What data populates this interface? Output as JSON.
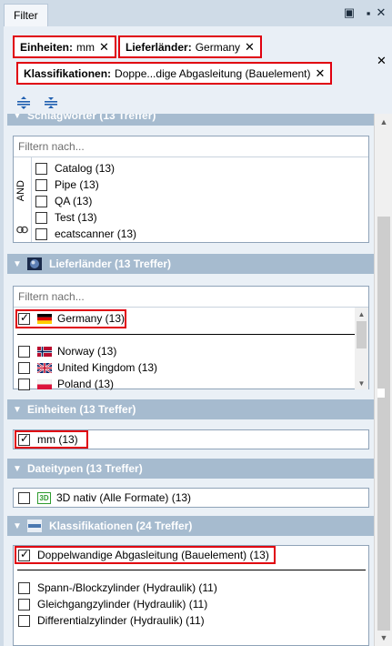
{
  "window": {
    "tab_label": "Filter",
    "pin_glyph": "▣",
    "restore_glyph": "▪",
    "close_glyph": "✕"
  },
  "active_filters": [
    {
      "key": "Einheiten:",
      "value": "mm"
    },
    {
      "key": "Lieferländer:",
      "value": "Germany"
    },
    {
      "key": "Klassifikationen:",
      "value": "Doppe...dige Abgasleitung (Bauelement)"
    }
  ],
  "chip_close_glyph": "✕",
  "filterbar_close_glyph": "✕",
  "placeholder": "Filtern nach...",
  "keywords": {
    "header_partial": "Schlagwörter (13 Treffer)",
    "and_label": "AND",
    "items": [
      "Catalog (13)",
      "Pipe (13)",
      "QA (13)",
      "Test (13)",
      "ecatscanner (13)"
    ]
  },
  "countries": {
    "header": "Lieferländer (13 Treffer)",
    "selected": "Germany (13)",
    "items": [
      "Norway (13)",
      "United Kingdom (13)",
      "Poland (13)"
    ]
  },
  "units": {
    "header": "Einheiten (13 Treffer)",
    "selected": "mm (13)"
  },
  "filetypes": {
    "header": "Dateitypen (13 Treffer)",
    "badge": "3D",
    "items": [
      "3D nativ (Alle Formate) (13)"
    ]
  },
  "classifications": {
    "header": "Klassifikationen (24 Treffer)",
    "selected": "Doppelwandige Abgasleitung (Bauelement) (13)",
    "items": [
      "Spann-/Blockzylinder (Hydraulik) (11)",
      "Gleichgangzylinder (Hydraulik) (11)",
      "Differentialzylinder (Hydraulik) (11)"
    ]
  },
  "colors": {
    "highlight": "#e0000f",
    "section_header": "#a6bbcf",
    "panel": "#eaf0f6"
  }
}
